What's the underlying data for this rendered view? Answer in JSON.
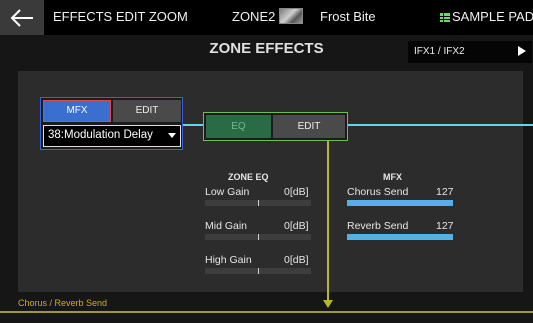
{
  "topbar": {
    "back_icon": "back-arrow-icon",
    "mode_title": "EFFECTS EDIT ZOOM",
    "zone_label": "ZONE2",
    "patch_name": "Frost Bite",
    "pad_icon": "grid-icon",
    "sample_pad_label": "SAMPLE PAD"
  },
  "header": {
    "title": "ZONE EFFECTS",
    "ifx_label": "IFX1 / IFX2"
  },
  "mfx": {
    "toggle_label": "MFX",
    "edit_label": "EDIT",
    "selected_type": "38:Modulation Delay"
  },
  "eq": {
    "toggle_label": "EQ",
    "edit_label": "EDIT"
  },
  "zone_eq": {
    "heading": "ZONE EQ",
    "rows": [
      {
        "label": "Low Gain",
        "value": "0[dB]",
        "level": 0.5
      },
      {
        "label": "Mid Gain",
        "value": "0[dB]",
        "level": 0.5
      },
      {
        "label": "High Gain",
        "value": "0[dB]",
        "level": 0.5
      }
    ]
  },
  "mfx_sends": {
    "heading": "MFX",
    "rows": [
      {
        "label": "Chorus Send",
        "value": "127",
        "level": 1.0
      },
      {
        "label": "Reverb Send",
        "value": "127",
        "level": 1.0
      }
    ]
  },
  "footer": {
    "chorus_reverb_label": "Chorus / Reverb Send"
  },
  "colors": {
    "accent_blue": "#3a6fd0",
    "mfx_border": "#3b5fe0",
    "eq_green": "#2a6a45",
    "signal_cyan": "#5fd8e8",
    "send_olive": "#b8b830",
    "send_bar": "#55b0e8"
  }
}
